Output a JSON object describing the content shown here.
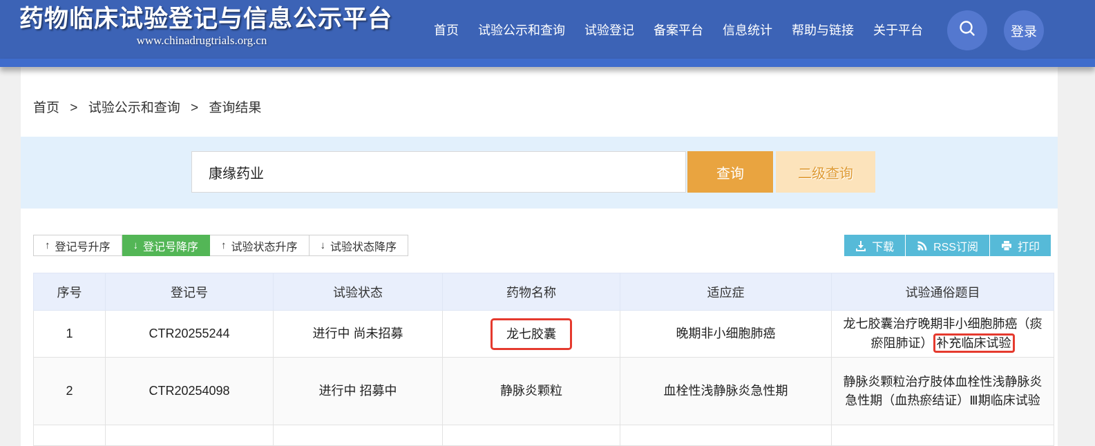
{
  "header": {
    "logo_title": "药物临床试验登记与信息公示平台",
    "logo_url": "www.chinadrugtrials.org.cn",
    "nav": [
      "首页",
      "试验公示和查询",
      "试验登记",
      "备案平台",
      "信息统计",
      "帮助与链接",
      "关于平台"
    ],
    "login_label": "登录"
  },
  "breadcrumb": {
    "items": [
      "首页",
      "试验公示和查询",
      "查询结果"
    ],
    "separator": ">"
  },
  "search": {
    "query": "康缘药业",
    "search_button": "查询",
    "secondary_button": "二级查询"
  },
  "toolbar": {
    "sort_buttons": [
      {
        "label": "登记号升序",
        "direction": "up",
        "active": false
      },
      {
        "label": "登记号降序",
        "direction": "down",
        "active": true
      },
      {
        "label": "试验状态升序",
        "direction": "up",
        "active": false
      },
      {
        "label": "试验状态降序",
        "direction": "down",
        "active": false
      }
    ],
    "actions": [
      {
        "label": "下载",
        "icon": "download-icon"
      },
      {
        "label": "RSS订阅",
        "icon": "rss-icon"
      },
      {
        "label": "打印",
        "icon": "print-icon"
      }
    ]
  },
  "table": {
    "columns": [
      "序号",
      "登记号",
      "试验状态",
      "药物名称",
      "适应症",
      "试验通俗题目"
    ],
    "rows": [
      {
        "index": "1",
        "reg_no": "CTR20255244",
        "status": "进行中 尚未招募",
        "drug_name": "龙七胶囊",
        "drug_highlighted": true,
        "indication": "晚期非小细胞肺癌",
        "public_title": "龙七胶囊治疗晚期非小细胞肺癌（痰瘀阻肺证）",
        "title_highlighted_part": "补充临床试验"
      },
      {
        "index": "2",
        "reg_no": "CTR20254098",
        "status": "进行中 招募中",
        "drug_name": "静脉炎颗粒",
        "drug_highlighted": false,
        "indication": "血栓性浅静脉炎急性期",
        "public_title": "静脉炎颗粒治疗肢体血栓性浅静脉炎急性期（血热瘀结证）Ⅲ期临床试验",
        "title_highlighted_part": ""
      }
    ],
    "partial_next_row_visible": true
  },
  "colors": {
    "header_blue": "#3c63b6",
    "header_strip_blue": "#3f6ccc",
    "header_circle_blue": "#5478cf",
    "search_section_bg": "#e2f0fc",
    "accent_orange": "#e9a440",
    "secondary_orange_bg": "#fce3bb",
    "active_sort_green": "#53b656",
    "action_button_cyan": "#56bad8",
    "table_header_bg": "#e9effc",
    "annotation_red": "#e53a2e"
  }
}
